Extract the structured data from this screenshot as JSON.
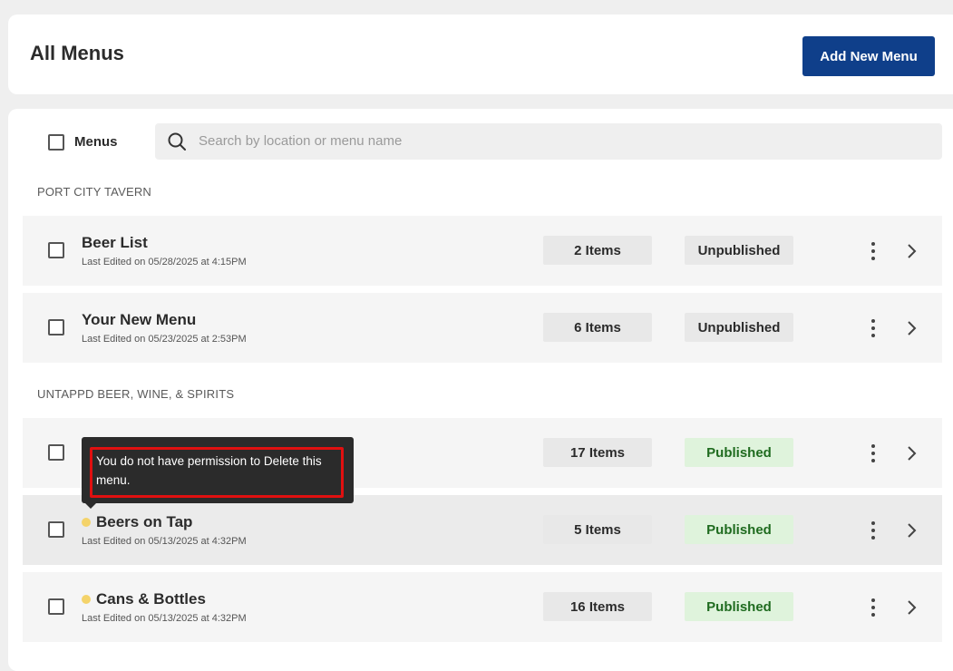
{
  "header": {
    "title": "All Menus",
    "add_button": "Add New Menu"
  },
  "list": {
    "select_all_label": "Menus",
    "search_placeholder": "Search by location or menu name",
    "sections": [
      {
        "name": "PORT CITY TAVERN",
        "rows": [
          {
            "title": "Beer List",
            "subtitle": "Last Edited on 05/28/2025 at 4:15PM",
            "count": "2 Items",
            "status": "Unpublished"
          },
          {
            "title": "Your New Menu",
            "subtitle": "Last Edited on 05/23/2025 at 2:53PM",
            "count": "6 Items",
            "status": "Unpublished"
          }
        ]
      },
      {
        "name": "UNTAPPD BEER, WINE, & SPIRITS",
        "rows": [
          {
            "title": "",
            "subtitle": "",
            "count": "17 Items",
            "status": "Published"
          },
          {
            "title": "Beers on Tap",
            "subtitle": "Last Edited on 05/13/2025 at 4:32PM",
            "count": "5 Items",
            "status": "Published"
          },
          {
            "title": "Cans & Bottles",
            "subtitle": "Last Edited on 05/13/2025 at 4:32PM",
            "count": "16 Items",
            "status": "Published"
          }
        ]
      }
    ]
  },
  "tooltip": {
    "text": "You do not have permission to Delete this menu."
  },
  "colors": {
    "primary": "#0f3f8a",
    "published_bg": "#dff3dc",
    "published_text": "#1f6b1f",
    "draft_dot": "#f4d36a",
    "highlight": "#e01010"
  }
}
